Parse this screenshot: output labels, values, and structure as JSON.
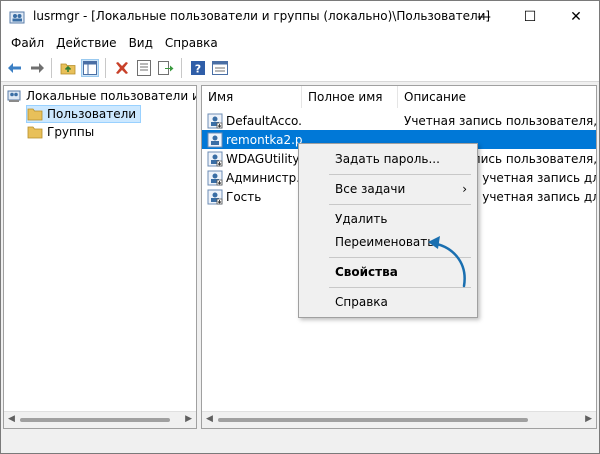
{
  "window": {
    "title": "lusrmgr - [Локальные пользователи и группы (локально)\\Пользователи]",
    "minimize_glyph": "—",
    "maximize_glyph": "☐",
    "close_glyph": "✕"
  },
  "menubar": {
    "items": [
      "Файл",
      "Действие",
      "Вид",
      "Справка"
    ]
  },
  "toolbar": {
    "icons": [
      "back-arrow-icon",
      "forward-arrow-icon",
      "folder-up-icon",
      "show-hide-tree-icon",
      "delete-x-icon",
      "properties-icon",
      "export-list-icon",
      "help-icon",
      "mmc-view-icon"
    ]
  },
  "tree": {
    "root": "Локальные пользователи и гру",
    "items": [
      {
        "label": "Пользователи",
        "selected": true
      },
      {
        "label": "Группы",
        "selected": false
      }
    ]
  },
  "list": {
    "columns": [
      "Имя",
      "Полное имя",
      "Описание"
    ],
    "rows": [
      {
        "name": "DefaultAcco...",
        "full_name": "",
        "description": "Учетная запись пользователя, у...",
        "selected": false
      },
      {
        "name": "remontka2.p...",
        "full_name": "",
        "description": "",
        "selected": true
      },
      {
        "name": "WDAGUtility...",
        "full_name": "",
        "description": "Учетная запись пользователя, у...",
        "selected": false
      },
      {
        "name": "Администр...",
        "full_name": "",
        "description": "Встроенная учетная запись для ...",
        "selected": false
      },
      {
        "name": "Гость",
        "full_name": "",
        "description": "Встроенная учетная запись для ...",
        "selected": false
      }
    ]
  },
  "context_menu": {
    "items": [
      {
        "label": "Задать пароль...",
        "bold": false
      },
      {
        "label": "Все задачи",
        "bold": false,
        "submenu_glyph": "›"
      },
      {
        "label": "Удалить",
        "bold": false
      },
      {
        "label": "Переименовать",
        "bold": false
      },
      {
        "label": "Свойства",
        "bold": true
      },
      {
        "label": "Справка",
        "bold": false
      }
    ]
  },
  "colors": {
    "selection": "#0078d7",
    "tree_selection": "#cce8ff",
    "annotation_arrow": "#1a6fb0",
    "folder": "#e8c05a"
  }
}
